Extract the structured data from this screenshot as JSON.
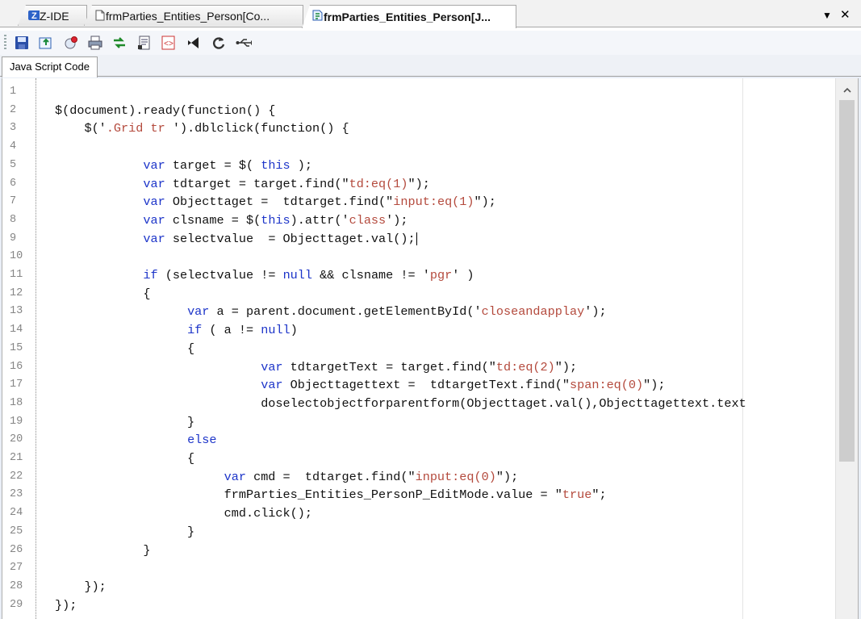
{
  "doc_tabs": [
    {
      "label": "Z-IDE",
      "icon": "z-ide-logo-icon"
    },
    {
      "label": "frmParties_Entities_Person[Co...",
      "icon": "document-icon"
    },
    {
      "label": "frmParties_Entities_Person[J...",
      "icon": "script-document-icon"
    }
  ],
  "tab_controls": {
    "dropdown_icon": "▼",
    "close_icon": "✕"
  },
  "toolbar": {
    "buttons": [
      "save-icon",
      "export-icon",
      "stamp-icon",
      "print-icon",
      "refresh-tables-icon",
      "settings-doc-icon",
      "html-tag-icon",
      "visual-studio-icon",
      "sync-icon",
      "usb-icon"
    ]
  },
  "sub_tabs": [
    {
      "label": "Java Script Code"
    }
  ],
  "editor": {
    "line_numbers": [
      "1",
      "2",
      "3",
      "4",
      "5",
      "6",
      "7",
      "8",
      "9",
      "10",
      "11",
      "12",
      "13",
      "14",
      "15",
      "16",
      "17",
      "18",
      "19",
      "20",
      "21",
      "22",
      "23",
      "24",
      "25",
      "26",
      "27",
      "28",
      "29"
    ],
    "lines": [
      "",
      "$(document).ready(function() {",
      "    $('.Grid tr ').dblclick(function() {",
      "",
      "            var target = $( this );",
      "            var tdtarget = target.find(\"td:eq(1)\");",
      "            var Objecttaget =  tdtarget.find(\"input:eq(1)\");",
      "            var clsname = $(this).attr('class');",
      "            var selectvalue  = Objecttaget.val();",
      "",
      "            if (selectvalue != null && clsname != 'pgr' )",
      "            {",
      "                  var a = parent.document.getElementById('closeandapplay');",
      "                  if ( a != null)",
      "                  {",
      "                            var tdtargetText = target.find(\"td:eq(2)\");",
      "                            var Objecttagettext =  tdtargetText.find(\"span:eq(0)\");",
      "                            doselectobjectforparentform(Objecttaget.val(),Objecttagettext.text",
      "                  }",
      "                  else",
      "                  {",
      "                       var cmd =  tdtarget.find(\"input:eq(0)\");",
      "                       frmParties_Entities_PersonP_EditMode.value = \"true\";",
      "                       cmd.click();",
      "                  }",
      "            }",
      "",
      "    });",
      "});"
    ]
  },
  "colors": {
    "keyword": "#1d35c9",
    "string": "#b44a3d",
    "line_number": "#858585"
  }
}
